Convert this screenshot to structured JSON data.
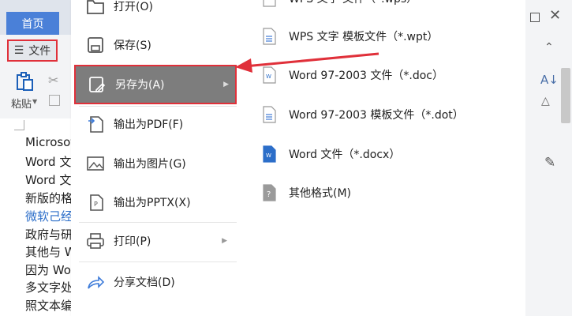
{
  "tabs": {
    "home": "首页"
  },
  "file_button": {
    "label": "文件"
  },
  "ribbon": {
    "paste_label": "粘贴"
  },
  "doc_lines": [
    {
      "text": "Microsoft",
      "blue": false
    },
    {
      "text": "Word 文",
      "blue": false
    },
    {
      "text": "Word 文化",
      "blue": false
    },
    {
      "text": "新版的格",
      "blue": false
    },
    {
      "text": "微软己经",
      "blue": true
    },
    {
      "text": "政府与研",
      "blue": false
    },
    {
      "text": "其他与 W",
      "blue": false
    },
    {
      "text": "因为 Wor",
      "blue": false
    },
    {
      "text": "多文字处",
      "blue": false
    },
    {
      "text": "照文本编",
      "blue": false
    }
  ],
  "menu": {
    "open": "打开(O)",
    "save": "保存(S)",
    "save_as": "另存为(A)",
    "export_pdf": "输出为PDF(F)",
    "export_image": "输出为图片(G)",
    "export_pptx": "输出为PPTX(X)",
    "print": "打印(P)",
    "share": "分享文档(D)"
  },
  "submenu": {
    "wps": "WPS 文字 文件（*.wps）",
    "wpt": "WPS 文字 模板文件（*.wpt）",
    "doc": "Word 97-2003 文件（*.doc）",
    "dot": "Word 97-2003 模板文件（*.dot）",
    "docx": "Word 文件（*.docx）",
    "other": "其他格式(M)"
  },
  "colors": {
    "accent": "#4a80d8",
    "highlight": "#e0303a",
    "selected": "#7d7d7d",
    "word_blue": "#2c6ec9"
  }
}
